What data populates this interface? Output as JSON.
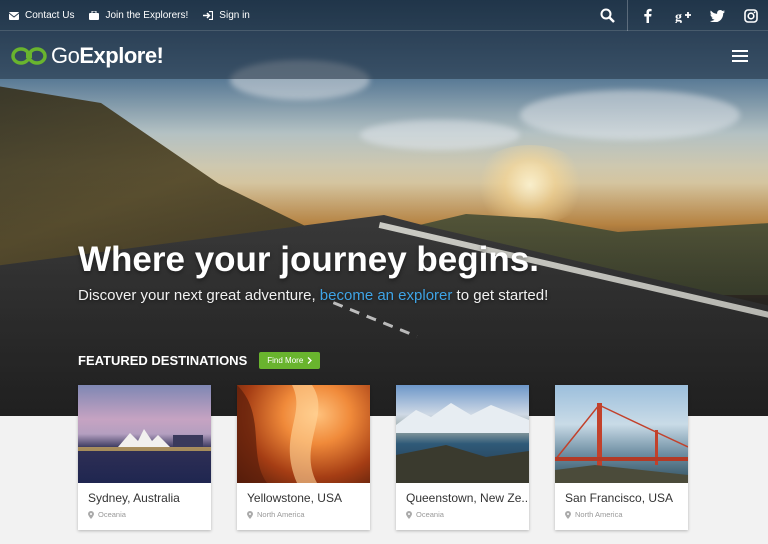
{
  "topbar": {
    "links": [
      {
        "label": "Contact Us",
        "icon": "envelope-icon"
      },
      {
        "label": "Join the Explorers!",
        "icon": "briefcase-icon"
      },
      {
        "label": "Sign in",
        "icon": "sign-in-icon"
      }
    ],
    "icons": [
      "search-icon",
      "facebook-icon",
      "google-plus-icon",
      "twitter-icon",
      "instagram-icon"
    ]
  },
  "header": {
    "logo_prefix": "Go",
    "logo_bold": "Explore!",
    "logo_icon": "binoculars-logo-icon",
    "menu_icon": "hamburger-menu-icon"
  },
  "hero": {
    "headline": "Where your journey begins.",
    "sub_before": "Discover your next great adventure,",
    "sub_link": "become an explorer",
    "sub_after": "to get started!"
  },
  "featured": {
    "title": "FEATURED DESTINATIONS",
    "button": "Find More",
    "button_icon": "chevron-right-icon"
  },
  "destinations": [
    {
      "name": "Sydney, Australia",
      "region": "Oceania"
    },
    {
      "name": "Yellowstone, USA",
      "region": "North America"
    },
    {
      "name": "Queenstown, New Ze..",
      "region": "Oceania"
    },
    {
      "name": "San Francisco, USA",
      "region": "North America"
    }
  ],
  "colors": {
    "accent_green": "#69b42e",
    "link_blue": "#3fa4e6"
  }
}
